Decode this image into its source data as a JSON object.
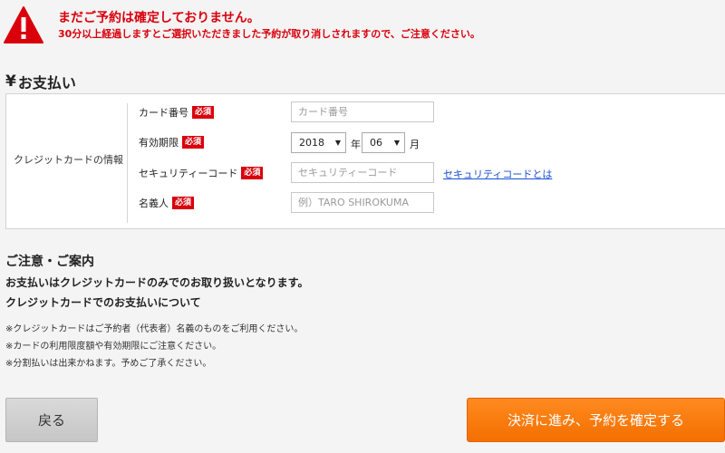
{
  "warning": {
    "title": "まだご予約は確定しておりません。",
    "message": "30分以上経過しますとご選択いただきました予約が取り消しされますので、ご注意ください。"
  },
  "payment": {
    "header": "お支払い",
    "yen_symbol": "¥",
    "section_label": "クレジットカードの情報",
    "required_badge": "必須",
    "card_number": {
      "label": "カード番号",
      "placeholder": "カード番号",
      "value": ""
    },
    "expiry": {
      "label": "有効期限",
      "year_value": "2018",
      "year_unit": "年",
      "month_value": "06",
      "month_unit": "月"
    },
    "security_code": {
      "label": "セキュリティーコード",
      "placeholder": "セキュリティーコード",
      "link_text": "セキュリティコードとは"
    },
    "holder_name": {
      "label": "名義人",
      "placeholder": "例）TARO SHIROKUMA"
    }
  },
  "notes": {
    "title": "ご注意・ご案内",
    "bold_line1": "お支払いはクレジットカードのみでのお取り扱いとなります。",
    "bold_line2": "クレジットカードでのお支払いについて",
    "items": [
      "※クレジットカードはご予約者（代表者）名義のものをご利用ください。",
      "※カードの利用限度額や有効期限にご注意ください。",
      "※分割払いは出来かねます。予めご了承ください。"
    ]
  },
  "buttons": {
    "back": "戻る",
    "confirm": "決済に進み、予約を確定する"
  },
  "colors": {
    "warning_red": "#d9000c",
    "confirm_orange": "#f47a0c",
    "link_blue": "#1a4fd6"
  }
}
